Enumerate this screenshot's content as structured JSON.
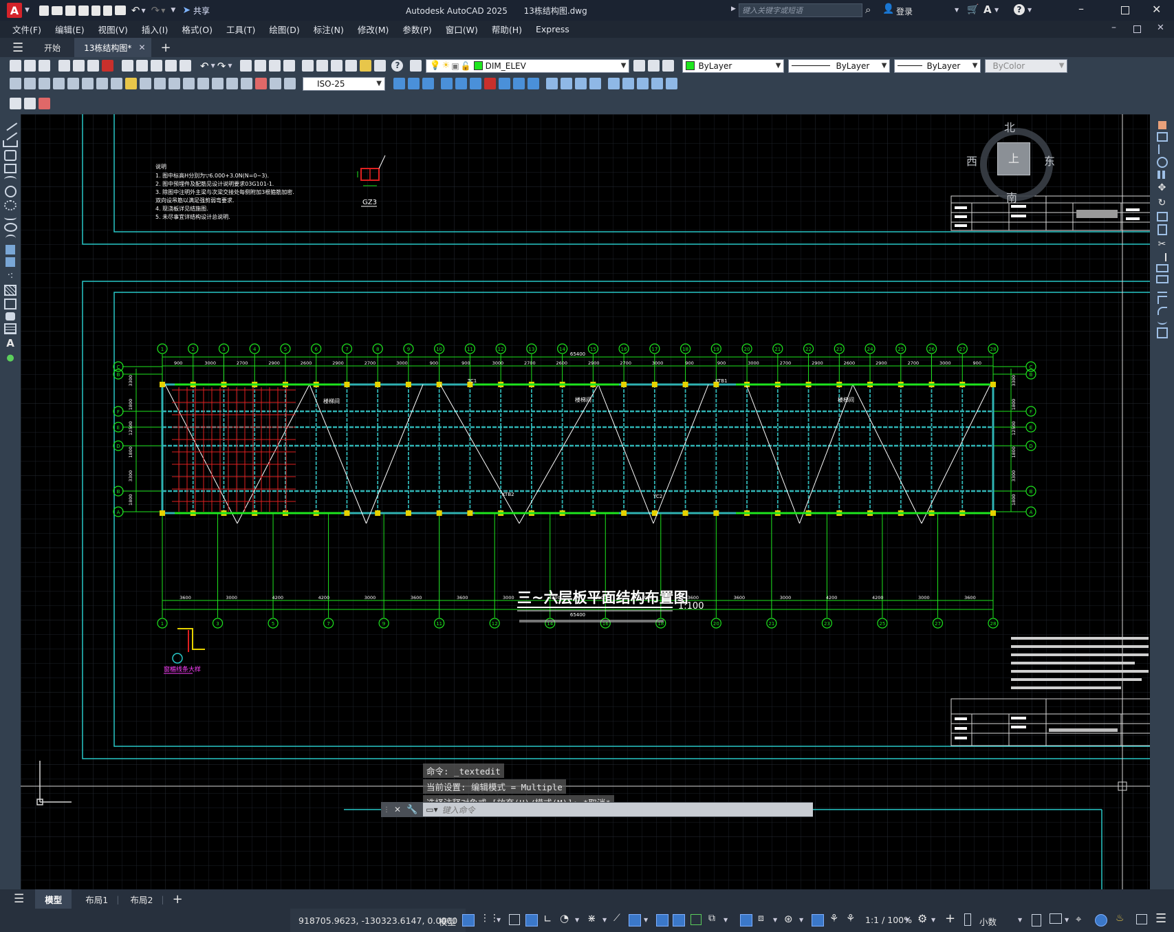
{
  "titlebar": {
    "app_title": "Autodesk AutoCAD 2025",
    "file_name": "13栋结构图.dwg",
    "share_label": "共享",
    "search_placeholder": "键入关键字或短语",
    "login_label": "登录"
  },
  "menubar": {
    "items": [
      "文件(F)",
      "编辑(E)",
      "视图(V)",
      "插入(I)",
      "格式(O)",
      "工具(T)",
      "绘图(D)",
      "标注(N)",
      "修改(M)",
      "参数(P)",
      "窗口(W)",
      "帮助(H)",
      "Express"
    ]
  },
  "tabs": {
    "start": "开始",
    "doc": "13栋结构图*"
  },
  "properties": {
    "layer": "DIM_ELEV",
    "color": "ByLayer",
    "linetype": "ByLayer",
    "lineweight": "ByLayer",
    "plotstyle": "ByColor",
    "dimstyle": "ISO-25"
  },
  "viewcube": {
    "north": "北",
    "south": "南",
    "east": "东",
    "west": "西",
    "top": "上"
  },
  "drawing": {
    "title": "三~六层板平面结构布置图",
    "scale": "1:100",
    "notes_title": "说明",
    "notes": [
      "1. 图中标高H分别为▽6.000+3.0N(N=0~3).",
      "2. 图中预埋件及配筋见设计说明要求03G101-1.",
      "3. 除图中注明外主梁与次梁交接处每侧附加3根箍筋加密.",
      "   双向设吊筋以满足强剪弱弯要求.",
      "4. 现浇板详见结施图.",
      "5. 未尽事宜详结构设计总说明."
    ],
    "gz_label": "GZ3",
    "detail_label": "窗楣线条大样",
    "top_total_dim": "65400",
    "bottom_total_dim": "65400",
    "top_dims": [
      "900",
      "3000",
      "2700",
      "2900",
      "2600",
      "2900",
      "2700",
      "3000",
      "900",
      "900",
      "3000",
      "2700",
      "2600",
      "2900",
      "2700",
      "3000",
      "900",
      "900",
      "3000",
      "2700",
      "2900",
      "2600",
      "2900",
      "2700",
      "3000",
      "900"
    ],
    "bottom_dims": [
      "3600",
      "3000",
      "4200",
      "4200",
      "3000",
      "3600",
      "3600",
      "3000",
      "4200",
      "3000",
      "3000",
      "3600",
      "3600",
      "3000",
      "4200",
      "4200",
      "3000",
      "3600"
    ],
    "left_dims": [
      "3300",
      "1800",
      "12500",
      "1800",
      "3300",
      "1800"
    ],
    "top_axes": [
      "1",
      "2",
      "3",
      "4",
      "5",
      "6",
      "7",
      "8",
      "9",
      "10",
      "11",
      "12",
      "13",
      "14",
      "15",
      "16",
      "17",
      "18",
      "19",
      "20",
      "21",
      "22",
      "23",
      "24",
      "25",
      "26",
      "27",
      "28"
    ],
    "bottom_axes": [
      "1",
      "3",
      "5",
      "7",
      "9",
      "11",
      "12",
      "14",
      "16",
      "18",
      "20",
      "21",
      "23",
      "25",
      "27",
      "28"
    ],
    "side_axes": [
      "C",
      "B",
      "F",
      "E",
      "D",
      "B",
      "A"
    ],
    "room_label": "楼梯间",
    "beam_labels": [
      "TC1",
      "TC2",
      "KTB1",
      "KTB2"
    ]
  },
  "command": {
    "history": [
      "命令: _textedit",
      "当前设置: 编辑模式 = Multiple",
      "选择注释对象或 [放弃(U)/模式(M)]: *取消*"
    ],
    "placeholder": "键入命令"
  },
  "layout_tabs": [
    "模型",
    "布局1",
    "布局2"
  ],
  "status": {
    "coords": "918705.9623, -130323.6147, 0.0000",
    "mode": "模型",
    "annotation_scale": "1:1 / 100%",
    "units": "小数"
  },
  "colors": {
    "accent_red": "#d4232a",
    "canvas_bg": "#000000",
    "frame_cyan": "#28c8c8",
    "wall_cyan": "#2fb3b3",
    "axis_green": "#1ee61e",
    "column_yellow": "#e6d200",
    "rebar_red": "#e02020",
    "note_white": "#ffffff"
  }
}
